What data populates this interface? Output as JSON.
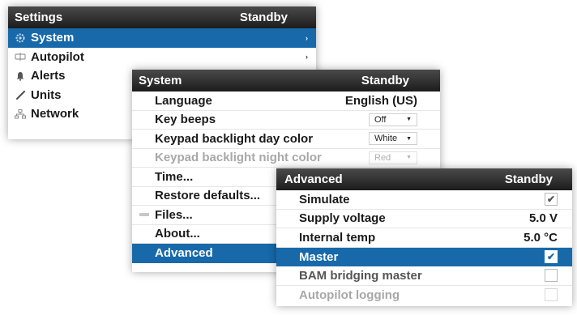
{
  "settings": {
    "title": "Settings",
    "status": "Standby",
    "items": [
      {
        "label": "System",
        "icon": "gear-icon",
        "arrow": "›"
      },
      {
        "label": "Autopilot",
        "icon": "autopilot-icon",
        "arrow": "›"
      },
      {
        "label": "Alerts",
        "icon": "bell-icon"
      },
      {
        "label": "Units",
        "icon": "ruler-icon"
      },
      {
        "label": "Network",
        "icon": "network-icon"
      }
    ]
  },
  "system": {
    "title": "System",
    "status": "Standby",
    "language": {
      "label": "Language",
      "value": "English (US)"
    },
    "key_beeps": {
      "label": "Key beeps",
      "value": "Off"
    },
    "day_color": {
      "label": "Keypad backlight day color",
      "value": "White"
    },
    "night_color": {
      "label": "Keypad backlight night color",
      "value": "Red"
    },
    "time": {
      "label": "Time..."
    },
    "restore": {
      "label": "Restore defaults..."
    },
    "files": {
      "label": "Files...",
      "icon": "folder-icon"
    },
    "about": {
      "label": "About..."
    },
    "advanced": {
      "label": "Advanced"
    }
  },
  "advanced": {
    "title": "Advanced",
    "status": "Standby",
    "simulate": {
      "label": "Simulate",
      "checked": true
    },
    "supply_voltage": {
      "label": "Supply voltage",
      "value": "5.0 V"
    },
    "internal_temp": {
      "label": "Internal temp",
      "value": "5.0 °C"
    },
    "master": {
      "label": "Master",
      "checked": true
    },
    "bam": {
      "label": "BAM bridging master",
      "checked": false
    },
    "ap_logging": {
      "label": "Autopilot logging",
      "checked": false
    }
  },
  "colors": {
    "selection": "#1769aa",
    "titlebar": "#2a2a2a"
  }
}
